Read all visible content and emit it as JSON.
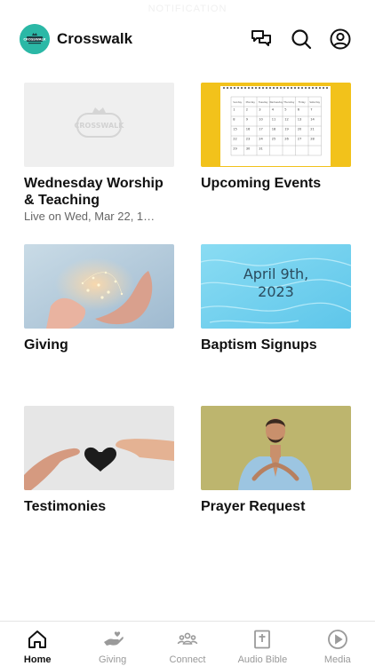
{
  "status_bar": {
    "faint_text": "NOTIFICATION"
  },
  "header": {
    "logo_text": "CROSSWALK",
    "title": "Crosswalk",
    "icons": [
      "chat-icon",
      "search-icon",
      "account-icon"
    ]
  },
  "cards": [
    {
      "title": "Wednesday Worship & Teaching",
      "subtitle": "Live on Wed, Mar 22, 1…",
      "image": "crosswalk-logo-placeholder",
      "watermark": "CROSSWALK"
    },
    {
      "title": "Upcoming Events",
      "subtitle": "",
      "image": "calendar-on-yellow",
      "calendar": {
        "weekdays": [
          "Sunday",
          "Monday",
          "Tuesday",
          "Wednesday",
          "Thursday",
          "Friday",
          "Saturday"
        ],
        "days": [
          "1",
          "2",
          "3",
          "4",
          "5",
          "6",
          "7",
          "8",
          "9",
          "10",
          "11",
          "12",
          "13",
          "14",
          "15",
          "16",
          "17",
          "18",
          "19",
          "20",
          "21",
          "22",
          "23",
          "24",
          "25",
          "26",
          "27",
          "28",
          "29",
          "30",
          "31"
        ]
      }
    },
    {
      "title": "Giving",
      "subtitle": "",
      "image": "hands-with-lights"
    },
    {
      "title": "Baptism Signups",
      "subtitle": "",
      "image": "water-ripples",
      "overlay_line1": "April 9th,",
      "overlay_line2": "2023"
    },
    {
      "title": "Testimonies",
      "subtitle": "",
      "image": "hands-passing-heart"
    },
    {
      "title": "Prayer Request",
      "subtitle": "",
      "image": "man-praying"
    }
  ],
  "tabs": [
    {
      "label": "Home",
      "icon": "home-icon",
      "active": true
    },
    {
      "label": "Giving",
      "icon": "giving-hand-icon",
      "active": false
    },
    {
      "label": "Connect",
      "icon": "people-icon",
      "active": false
    },
    {
      "label": "Audio Bible",
      "icon": "bible-icon",
      "active": false
    },
    {
      "label": "Media",
      "icon": "play-circle-icon",
      "active": false
    }
  ],
  "colors": {
    "brand_teal": "#2bb8a6",
    "events_yellow": "#f2c21b",
    "prayer_olive": "#bdb56e",
    "baptism_blue": "#7fd3ee"
  }
}
